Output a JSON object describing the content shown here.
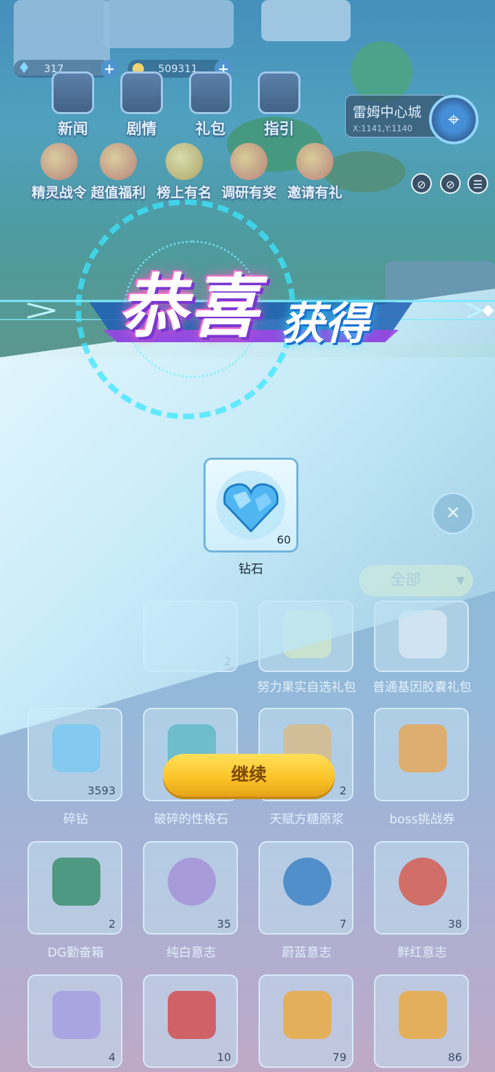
{
  "hud": {
    "diamond_count": "317",
    "coin_count": "509311",
    "top_buttons": [
      {
        "label": "新闻",
        "icon": "news-icon"
      },
      {
        "label": "剧情",
        "icon": "story-icon"
      },
      {
        "label": "礼包",
        "icon": "gift-pack-icon"
      },
      {
        "label": "指引",
        "icon": "guide-icon"
      }
    ],
    "event_buttons": [
      {
        "label": "精灵战令",
        "icon": "battle-pass-icon"
      },
      {
        "label": "超值福利",
        "icon": "welfare-icon"
      },
      {
        "label": "榜上有名",
        "icon": "trophy-icon"
      },
      {
        "label": "调研有奖",
        "icon": "survey-icon"
      },
      {
        "label": "邀请有礼",
        "icon": "invite-icon"
      }
    ],
    "location": {
      "name": "雷姆中心城",
      "coords": "X:1141,Y:1140"
    }
  },
  "inventory": {
    "filter_label": "全部",
    "rows": [
      [
        {
          "name": "",
          "count": "2"
        },
        {
          "name": "努力果实自选礼包",
          "count": ""
        },
        {
          "name": "普通基因胶囊礼包",
          "count": ""
        }
      ],
      [
        {
          "name": "碎钻",
          "count": "3593"
        },
        {
          "name": "破碎的性格石",
          "count": ""
        },
        {
          "name": "天赋方糖原浆",
          "count": "2"
        },
        {
          "name": "boss挑战券",
          "count": ""
        }
      ],
      [
        {
          "name": "DG勤奋箱",
          "count": "2"
        },
        {
          "name": "纯白意志",
          "count": "35"
        },
        {
          "name": "蔚蓝意志",
          "count": "7"
        },
        {
          "name": "鲜红意志",
          "count": "38"
        }
      ],
      [
        {
          "name": "",
          "count": "4"
        },
        {
          "name": "",
          "count": "10"
        },
        {
          "name": "",
          "count": "79"
        },
        {
          "name": "",
          "count": "86"
        }
      ]
    ]
  },
  "reward_dialog": {
    "title_main": "恭喜",
    "title_sub": "获得",
    "item_name": "钻石",
    "item_count": "60",
    "continue_label": "继续"
  },
  "colors": {
    "accent_yellow": "#fbc226",
    "title_pink": "#ff6fd1",
    "title_purple": "#7a37d0",
    "cyan_glow": "#28d4ff"
  }
}
